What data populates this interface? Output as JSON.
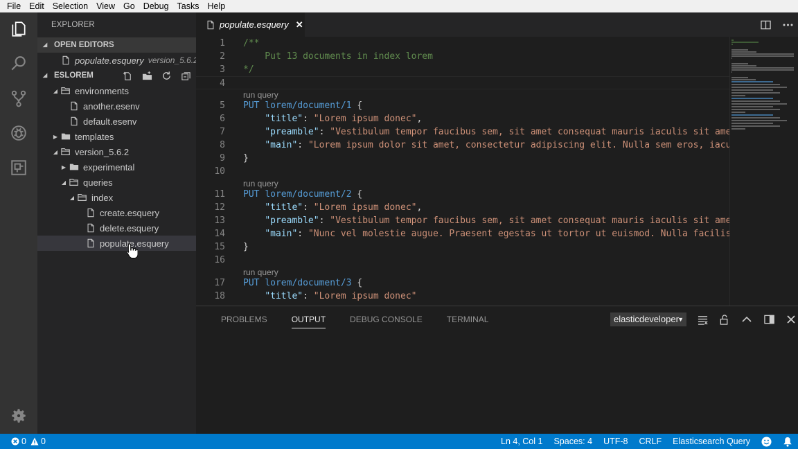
{
  "menu": [
    "File",
    "Edit",
    "Selection",
    "View",
    "Go",
    "Debug",
    "Tasks",
    "Help"
  ],
  "explorer": {
    "title": "EXPLORER",
    "open_editors_header": "OPEN EDITORS",
    "open_editor": {
      "name": "populate.esquery",
      "desc": "version_5.6.2..."
    },
    "workspace_header": "ESLOREM",
    "tree": [
      {
        "label": "environments",
        "kind": "folder-open",
        "indent": 1
      },
      {
        "label": "another.esenv",
        "kind": "file",
        "indent": 2
      },
      {
        "label": "default.esenv",
        "kind": "file",
        "indent": 2
      },
      {
        "label": "templates",
        "kind": "folder-closed",
        "indent": 1
      },
      {
        "label": "version_5.6.2",
        "kind": "folder-open",
        "indent": 1
      },
      {
        "label": "experimental",
        "kind": "folder-closed",
        "indent": 2
      },
      {
        "label": "queries",
        "kind": "folder-open",
        "indent": 2
      },
      {
        "label": "index",
        "kind": "folder-open",
        "indent": 3
      },
      {
        "label": "create.esquery",
        "kind": "file",
        "indent": 4
      },
      {
        "label": "delete.esquery",
        "kind": "file",
        "indent": 4
      },
      {
        "label": "populate.esquery",
        "kind": "file",
        "indent": 4,
        "selected": true
      }
    ]
  },
  "tab": {
    "label": "populate.esquery",
    "close": "✕"
  },
  "editor": {
    "lens_label": "run query",
    "lines": [
      {
        "n": "1",
        "parts": [
          [
            "c-com",
            "/**"
          ]
        ]
      },
      {
        "n": "2",
        "parts": [
          [
            "c-com",
            "    Put 13 documents in index lorem"
          ]
        ]
      },
      {
        "n": "3",
        "parts": [
          [
            "c-com",
            "*/"
          ]
        ]
      },
      {
        "n": "4",
        "parts": [],
        "current": true
      },
      {
        "lens": true
      },
      {
        "n": "5",
        "parts": [
          [
            "c-kw",
            "PUT"
          ],
          [
            "c-pl",
            " "
          ],
          [
            "c-kw",
            "lorem/document/1"
          ],
          [
            "c-pl",
            " {"
          ]
        ]
      },
      {
        "n": "6",
        "parts": [
          [
            "c-pl",
            "    "
          ],
          [
            "c-key",
            "\"title\""
          ],
          [
            "c-pl",
            ": "
          ],
          [
            "c-str",
            "\"Lorem ipsum donec\""
          ],
          [
            "c-pl",
            ","
          ]
        ]
      },
      {
        "n": "7",
        "parts": [
          [
            "c-pl",
            "    "
          ],
          [
            "c-key",
            "\"preamble\""
          ],
          [
            "c-pl",
            ": "
          ],
          [
            "c-str",
            "\"Vestibulum tempor faucibus sem, sit amet consequat mauris iaculis sit amet"
          ]
        ]
      },
      {
        "n": "8",
        "parts": [
          [
            "c-pl",
            "    "
          ],
          [
            "c-key",
            "\"main\""
          ],
          [
            "c-pl",
            ": "
          ],
          [
            "c-str",
            "\"Lorem ipsum dolor sit amet, consectetur adipiscing elit. Nulla sem eros, iacul"
          ]
        ]
      },
      {
        "n": "9",
        "parts": [
          [
            "c-pl",
            "}"
          ]
        ]
      },
      {
        "n": "10",
        "parts": []
      },
      {
        "lens": true
      },
      {
        "n": "11",
        "parts": [
          [
            "c-kw",
            "PUT"
          ],
          [
            "c-pl",
            " "
          ],
          [
            "c-kw",
            "lorem/document/2"
          ],
          [
            "c-pl",
            " {"
          ]
        ]
      },
      {
        "n": "12",
        "parts": [
          [
            "c-pl",
            "    "
          ],
          [
            "c-key",
            "\"title\""
          ],
          [
            "c-pl",
            ": "
          ],
          [
            "c-str",
            "\"Lorem ipsum donec\""
          ],
          [
            "c-pl",
            ","
          ]
        ]
      },
      {
        "n": "13",
        "parts": [
          [
            "c-pl",
            "    "
          ],
          [
            "c-key",
            "\"preamble\""
          ],
          [
            "c-pl",
            ": "
          ],
          [
            "c-str",
            "\"Vestibulum tempor faucibus sem, sit amet consequat mauris iaculis sit amet'"
          ]
        ]
      },
      {
        "n": "14",
        "parts": [
          [
            "c-pl",
            "    "
          ],
          [
            "c-key",
            "\"main\""
          ],
          [
            "c-pl",
            ": "
          ],
          [
            "c-str",
            "\"Nunc vel molestie augue. Praesent egestas ut tortor ut euismod. Nulla facilisi"
          ]
        ]
      },
      {
        "n": "15",
        "parts": [
          [
            "c-pl",
            "}"
          ]
        ]
      },
      {
        "n": "16",
        "parts": []
      },
      {
        "lens": true
      },
      {
        "n": "17",
        "parts": [
          [
            "c-kw",
            "PUT"
          ],
          [
            "c-pl",
            " "
          ],
          [
            "c-kw",
            "lorem/document/3"
          ],
          [
            "c-pl",
            " {"
          ]
        ]
      },
      {
        "n": "18",
        "parts": [
          [
            "c-pl",
            "    "
          ],
          [
            "c-key",
            "\"title\""
          ],
          [
            "c-pl",
            ": "
          ],
          [
            "c-str",
            "\"Lorem ipsum donec\""
          ]
        ]
      }
    ]
  },
  "panel": {
    "tabs": [
      "PROBLEMS",
      "OUTPUT",
      "DEBUG CONSOLE",
      "TERMINAL"
    ],
    "active_tab": "OUTPUT",
    "channel": "elasticdeveloper"
  },
  "status": {
    "errors": "0",
    "warnings": "0",
    "position": "Ln 4, Col 1",
    "spaces": "Spaces: 4",
    "encoding": "UTF-8",
    "eol": "CRLF",
    "language": "Elasticsearch Query"
  },
  "colors": {
    "statusbar": "#007acc",
    "activitybar": "#333333",
    "sidebar": "#252526",
    "editor": "#1e1e1e"
  }
}
